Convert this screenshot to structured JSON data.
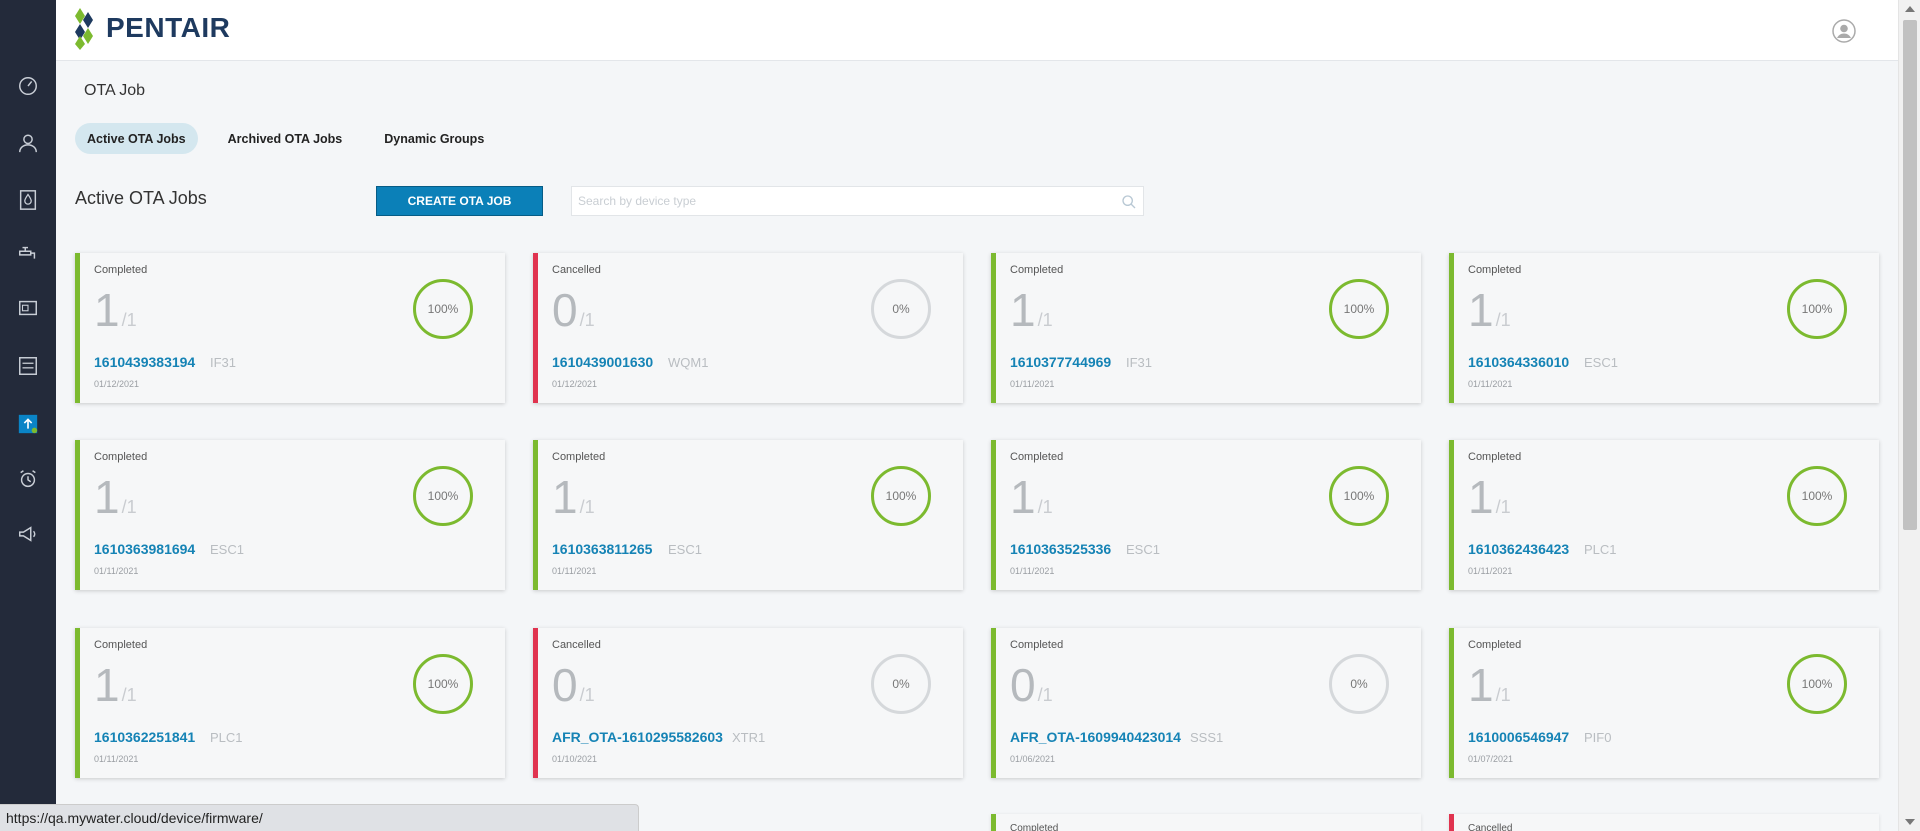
{
  "header": {
    "logo_text": "PENTAIR",
    "avatar_icon": "user-circle-icon"
  },
  "sidebar": {
    "items": [
      {
        "name": "dashboard-gauge-icon"
      },
      {
        "name": "user-icon"
      },
      {
        "name": "water-drop-icon"
      },
      {
        "name": "faucet-icon"
      },
      {
        "name": "device-icon"
      },
      {
        "name": "checklist-icon"
      },
      {
        "name": "ota-upload-icon",
        "active": true
      },
      {
        "name": "alarm-clock-icon"
      },
      {
        "name": "megaphone-icon"
      }
    ]
  },
  "page": {
    "title": "OTA Job",
    "tabs": [
      {
        "label": "Active OTA Jobs",
        "active": true
      },
      {
        "label": "Archived OTA Jobs"
      },
      {
        "label": "Dynamic Groups"
      }
    ],
    "section_title": "Active OTA Jobs",
    "create_button": "CREATE OTA JOB",
    "search_placeholder": "Search by device type"
  },
  "jobs": [
    {
      "status": "Completed",
      "count": "1",
      "total": "/1",
      "job_id": "1610439383194",
      "device": "IF31",
      "date": "01/12/2021",
      "percent": "100%"
    },
    {
      "status": "Cancelled",
      "count": "0",
      "total": "/1",
      "job_id": "1610439001630",
      "device": "WQM1",
      "date": "01/12/2021",
      "percent": "0%"
    },
    {
      "status": "Completed",
      "count": "1",
      "total": "/1",
      "job_id": "1610377744969",
      "device": "IF31",
      "date": "01/11/2021",
      "percent": "100%"
    },
    {
      "status": "Completed",
      "count": "1",
      "total": "/1",
      "job_id": "1610364336010",
      "device": "ESC1",
      "date": "01/11/2021",
      "percent": "100%"
    },
    {
      "status": "Completed",
      "count": "1",
      "total": "/1",
      "job_id": "1610363981694",
      "device": "ESC1",
      "date": "01/11/2021",
      "percent": "100%"
    },
    {
      "status": "Completed",
      "count": "1",
      "total": "/1",
      "job_id": "1610363811265",
      "device": "ESC1",
      "date": "01/11/2021",
      "percent": "100%"
    },
    {
      "status": "Completed",
      "count": "1",
      "total": "/1",
      "job_id": "1610363525336",
      "device": "ESC1",
      "date": "01/11/2021",
      "percent": "100%"
    },
    {
      "status": "Completed",
      "count": "1",
      "total": "/1",
      "job_id": "1610362436423",
      "device": "PLC1",
      "date": "01/11/2021",
      "percent": "100%"
    },
    {
      "status": "Completed",
      "count": "1",
      "total": "/1",
      "job_id": "1610362251841",
      "device": "PLC1",
      "date": "01/11/2021",
      "percent": "100%"
    },
    {
      "status": "Cancelled",
      "count": "0",
      "total": "/1",
      "job_id": "AFR_OTA-1610295582603",
      "device": "XTR1",
      "date": "01/10/2021",
      "percent": "0%"
    },
    {
      "status": "Completed",
      "count": "0",
      "total": "/1",
      "job_id": "AFR_OTA-1609940423014",
      "device": "SSS1",
      "date": "01/06/2021",
      "percent": "0%"
    },
    {
      "status": "Completed",
      "count": "1",
      "total": "/1",
      "job_id": "1610006546947",
      "device": "PIF0",
      "date": "01/07/2021",
      "percent": "100%"
    }
  ],
  "partial_row": [
    {
      "status": "Completed"
    },
    {
      "status": "Cancelled"
    }
  ],
  "status_bar": {
    "url": "https://qa.mywater.cloud/device/firmware/"
  },
  "colors": {
    "sidebar": "#232a3a",
    "completed": "#7cba2f",
    "cancelled": "#e0334f",
    "primary": "#0b80b8",
    "link": "#1583b5"
  }
}
